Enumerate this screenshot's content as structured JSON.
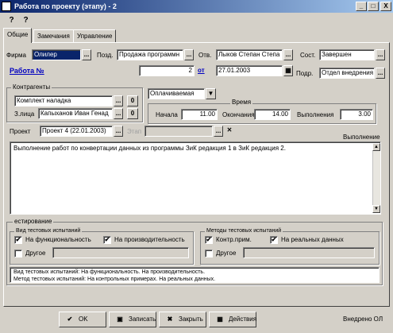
{
  "window": {
    "title": "Работа по проекту (этапу) - 2",
    "controls": [
      "_",
      "□",
      "X"
    ]
  },
  "toolbar": {
    "help_icon": "?",
    "context_help_icon": "?"
  },
  "tabs": [
    {
      "label": "Общие"
    },
    {
      "label": "Замечания"
    },
    {
      "label": "Управление"
    }
  ],
  "general": {
    "firm_label": "Фирма",
    "firm_value": "Олилер",
    "position_label": "Позд.",
    "position_value": "Продажа программн",
    "responsible_label": "Отв.",
    "responsible_value": "Лыков Степан Степа",
    "state_label": "Сост.",
    "state_value": "Завершен",
    "work_link": "Работа №",
    "work_number": "2",
    "from_label": "от",
    "work_date": "27.01.2003",
    "department_label": "Подр.",
    "department_value": "Отдел внедрения"
  },
  "contractors": {
    "title": "Контрагенты",
    "client_value": "Комплект наладка",
    "client_count": "0",
    "contact_label": "З.лица",
    "contact_value": "Капыханов Иван Генад",
    "contact_count": "0"
  },
  "payment": {
    "value": "Оплачиваемая"
  },
  "time": {
    "title": "Время",
    "start_label": "Начала",
    "start_value": "11.00",
    "end_label": "Окончания",
    "end_value": "14.00",
    "done_label": "Выполнения",
    "done_value": "3.00"
  },
  "project": {
    "label": "Проект",
    "value": "Проект 4 (22.01.2003)",
    "stage_label": "Этап"
  },
  "execution": {
    "title": "Выполнение",
    "text": "Выполнение работ по конвертации данных из программы ЗиК редакция 1 в ЗиК редакция 2."
  },
  "testing": {
    "title": "естирование",
    "kinds_title": "Вид тестовых испытаний",
    "kind_functionality": "На функциональность",
    "kind_functionality_checked": "✔",
    "kind_performance": "На производительность",
    "kind_performance_checked": "✔",
    "kind_other": "Другое",
    "methods_title": "Методы тестовых испытаний",
    "method_control": "Контр.прим.",
    "method_control_checked": "✔",
    "method_real": "На реальных данных",
    "method_real_checked": "✔",
    "method_other": "Другое",
    "summary_line1": "Вид тестовых испытаний: На функциональность. На производительность.",
    "summary_line2": "Метод тестовых испытаний: На контрольных примерах. На реальных данных."
  },
  "buttons": {
    "ok": "OK",
    "save": "Записать",
    "close": "Закрыть",
    "actions": "Действия",
    "ok_icon": "✔",
    "save_icon": "▣",
    "close_icon": "✖",
    "actions_icon": "▦"
  },
  "footer": {
    "status": "Внедрено ОЛ"
  }
}
